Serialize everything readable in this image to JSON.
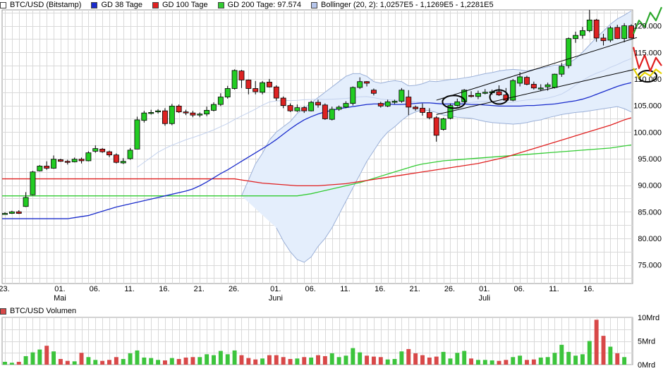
{
  "colors": {
    "up_candle": "#22cc22",
    "down_candle": "#dd2222",
    "gd38": "#1a2ccc",
    "gd100": "#e02020",
    "gd200": "#33cc33",
    "bollinger_fill": "#e4eefc",
    "bollinger_line": "#9bb0d8",
    "volume_up": "#3cc43c",
    "volume_down": "#d84848",
    "grid": "#d9d9d9"
  },
  "legend": {
    "items": [
      {
        "label": "BTC/USD (Bitstamp)",
        "color": "#ffffff"
      },
      {
        "label": "GD 38 Tage",
        "color": "#1a2ccc"
      },
      {
        "label": "GD 100 Tage",
        "color": "#e02020"
      },
      {
        "label": "GD 200 Tage: 97.574",
        "color": "#33cc33"
      },
      {
        "label": "Bollinger (20, 2): 1,0257E5 - 1,1269E5 - 1,2281E5",
        "color": "#b6c6ec"
      }
    ]
  },
  "volume_legend": {
    "label": "BTC/USD Volumen",
    "color": "#d84848"
  },
  "chart_data": [
    {
      "type": "candlestick",
      "title": "BTC/USD (Bitstamp)",
      "y_ticks": [
        "75.000",
        "80.000",
        "85.000",
        "90.000",
        "95.000",
        "100.000",
        "105.000",
        "110.000",
        "115.000",
        "120.000"
      ],
      "y_tick_values": [
        75000,
        80000,
        85000,
        90000,
        95000,
        100000,
        105000,
        110000,
        115000,
        120000
      ],
      "ylim": [
        71500,
        123000
      ],
      "x_day_labels": [
        "23.",
        "01.",
        "06.",
        "11.",
        "16.",
        "21.",
        "26.",
        "01.",
        "06.",
        "11.",
        "16.",
        "21.",
        "26.",
        "01.",
        "06.",
        "11.",
        "16."
      ],
      "x_day_label_index": [
        0,
        8,
        13,
        18,
        23,
        28,
        33,
        39,
        44,
        49,
        54,
        59,
        64,
        69,
        74,
        79,
        84
      ],
      "month_labels": [
        "Mai",
        "Juni",
        "Juli"
      ],
      "month_label_index": [
        8,
        39,
        69
      ],
      "dates_start": "2025-04-20",
      "candles": [
        [
          84600,
          84900,
          84500,
          84700
        ],
        [
          84700,
          85200,
          84600,
          85000
        ],
        [
          85000,
          85300,
          84600,
          84700
        ],
        [
          86000,
          88700,
          85900,
          87700
        ],
        [
          88200,
          92700,
          88100,
          92500
        ],
        [
          92700,
          93800,
          92600,
          93600
        ],
        [
          93600,
          94500,
          92900,
          93200
        ],
        [
          93200,
          95600,
          93100,
          94900
        ],
        [
          94800,
          95000,
          94400,
          94500
        ],
        [
          94500,
          94800,
          93900,
          94400
        ],
        [
          94400,
          95200,
          94300,
          94900
        ],
        [
          94900,
          95200,
          94100,
          94600
        ],
        [
          94600,
          96400,
          94500,
          96100
        ],
        [
          96400,
          97500,
          96100,
          96900
        ],
        [
          96800,
          97000,
          96100,
          96300
        ],
        [
          96300,
          96500,
          95300,
          95700
        ],
        [
          95700,
          96000,
          94100,
          94300
        ],
        [
          94200,
          95100,
          94000,
          94500
        ],
        [
          95000,
          97000,
          94800,
          96600
        ],
        [
          96800,
          102900,
          96800,
          102300
        ],
        [
          102200,
          104000,
          101800,
          103600
        ],
        [
          103500,
          104200,
          103300,
          103700
        ],
        [
          103800,
          104300,
          103500,
          104000
        ],
        [
          104000,
          104500,
          101200,
          101600
        ],
        [
          101600,
          105300,
          101300,
          104900
        ],
        [
          104900,
          105200,
          103600,
          103800
        ],
        [
          103800,
          104200,
          103200,
          103600
        ],
        [
          103600,
          104000,
          102800,
          103200
        ],
        [
          103300,
          103700,
          102800,
          103400
        ],
        [
          103400,
          104800,
          103000,
          104100
        ],
        [
          104100,
          105600,
          103900,
          105200
        ],
        [
          105200,
          107300,
          104900,
          106600
        ],
        [
          106600,
          108700,
          106300,
          108200
        ],
        [
          108200,
          111800,
          108000,
          111600
        ],
        [
          111500,
          111700,
          108300,
          109800
        ],
        [
          109800,
          109900,
          107100,
          108200
        ],
        [
          108200,
          109600,
          107100,
          107600
        ],
        [
          107500,
          109600,
          107100,
          109300
        ],
        [
          109400,
          110000,
          108400,
          108500
        ],
        [
          108500,
          108800,
          105900,
          106400
        ],
        [
          106400,
          106700,
          104500,
          105000
        ],
        [
          105000,
          105400,
          103800,
          104000
        ],
        [
          104000,
          105200,
          103800,
          104600
        ],
        [
          104600,
          104900,
          103600,
          104000
        ],
        [
          104000,
          105900,
          103900,
          105600
        ],
        [
          105600,
          106100,
          104600,
          105100
        ],
        [
          105100,
          105400,
          102300,
          102500
        ],
        [
          102400,
          104800,
          102200,
          104300
        ],
        [
          104300,
          105000,
          104000,
          104700
        ],
        [
          104700,
          105800,
          104500,
          105400
        ],
        [
          105400,
          108600,
          105000,
          108400
        ],
        [
          108400,
          110300,
          108100,
          109500
        ],
        [
          109500,
          109600,
          108600,
          109200
        ],
        [
          107900,
          108200,
          106900,
          107300
        ],
        [
          105400,
          105700,
          104600,
          104900
        ],
        [
          104900,
          106100,
          104700,
          105700
        ],
        [
          105600,
          106100,
          105300,
          105800
        ],
        [
          105800,
          108300,
          105500,
          107900
        ],
        [
          106600,
          107900,
          103200,
          104700
        ],
        [
          104700,
          105000,
          104000,
          104400
        ],
        [
          104500,
          105400,
          103100,
          103700
        ],
        [
          103700,
          104500,
          102400,
          102700
        ],
        [
          102700,
          103000,
          98200,
          99400
        ],
        [
          100500,
          102700,
          100300,
          102500
        ],
        [
          102600,
          105400,
          102400,
          105000
        ],
        [
          105000,
          106300,
          104800,
          105700
        ],
        [
          105700,
          108100,
          105600,
          107900
        ],
        [
          106900,
          107700,
          106500,
          106800
        ],
        [
          106700,
          107800,
          106200,
          107300
        ],
        [
          107300,
          108100,
          107100,
          107500
        ],
        [
          107400,
          108000,
          107000,
          107600
        ],
        [
          107600,
          108800,
          106800,
          107000
        ],
        [
          107000,
          108300,
          105800,
          106000
        ],
        [
          106000,
          110000,
          105800,
          109700
        ],
        [
          109200,
          111300,
          108600,
          110400
        ],
        [
          110300,
          110600,
          108800,
          109000
        ],
        [
          109000,
          109500,
          108000,
          108300
        ],
        [
          108200,
          109000,
          107700,
          108300
        ],
        [
          108500,
          109300,
          107800,
          108900
        ],
        [
          108400,
          111000,
          108200,
          110900
        ],
        [
          110900,
          113000,
          110400,
          112400
        ],
        [
          112500,
          117800,
          112000,
          117600
        ],
        [
          117600,
          118900,
          116800,
          118200
        ],
        [
          118200,
          119800,
          117600,
          119100
        ],
        [
          119100,
          123000,
          118800,
          121100
        ],
        [
          121100,
          121300,
          117000,
          117700
        ],
        [
          117700,
          118500,
          116300,
          117200
        ],
        [
          117300,
          120000,
          116900,
          119600
        ],
        [
          119700,
          120200,
          117500,
          117600
        ],
        [
          117600,
          120500,
          116900,
          120000
        ],
        [
          120000,
          120300,
          117600,
          117700
        ]
      ],
      "bollinger_upper": [
        88000,
        91000,
        94000,
        96000,
        98500,
        100000,
        101000,
        102000,
        103500,
        104500,
        105500,
        106500,
        107500,
        108500,
        109500,
        110500,
        111000,
        111000,
        110500,
        109500,
        109200,
        109500,
        109700,
        109500,
        108700,
        108800,
        109100,
        109600,
        109500,
        109700,
        109900,
        110000,
        110200,
        110400,
        110700,
        111000,
        111200,
        111500,
        111700,
        111800,
        111700,
        111500,
        111800,
        112000,
        112300,
        112600,
        112600,
        113000,
        113800,
        115000,
        116400,
        117800,
        119000,
        120300,
        121300,
        122000,
        122800
      ],
      "bollinger_upper_start": 34,
      "bollinger_lower": [
        82000,
        79500,
        77500,
        76000,
        75500,
        76500,
        78500,
        80000,
        82000,
        84500,
        87000,
        89500,
        92000,
        94500,
        96500,
        98500,
        100000,
        101000,
        102200,
        103200,
        103800,
        104200,
        104000,
        103700,
        103200,
        103000,
        102800,
        102700,
        102600,
        102300,
        102000,
        101800,
        101700,
        101600,
        101500,
        101600,
        101800,
        102100,
        102300,
        102700,
        103000,
        103300,
        103500,
        103700,
        103800,
        104000,
        104200,
        104400,
        104600,
        104800,
        104400,
        103800
      ],
      "bollinger_lower_start": 39,
      "gd38": [
        83700,
        83900,
        84100,
        84300,
        84700,
        85100,
        85500,
        85900,
        86200,
        86500,
        86800,
        87100,
        87400,
        87700,
        88000,
        88300,
        88600,
        88900,
        89300,
        89900,
        90600,
        91400,
        92200,
        92900,
        93700,
        94500,
        95300,
        96100,
        96900,
        97700,
        98600,
        99600,
        100600,
        101500,
        102300,
        102900,
        103400,
        103800,
        104100,
        104400,
        104600,
        104800,
        105000,
        105200,
        105300,
        105300,
        105300,
        105200,
        105200,
        105300,
        105400,
        105500,
        105500,
        105400,
        105300,
        105300,
        105300,
        105300,
        105200,
        105200,
        105100,
        105000,
        104900,
        104900,
        104900,
        104900,
        105000,
        105000,
        105100,
        105200,
        105300,
        105500,
        105700,
        105900,
        106200,
        106600,
        107100,
        107600,
        108100,
        108600,
        109000,
        109300
      ],
      "gd38_start": 12,
      "gd100": [
        91200,
        91000,
        90800,
        90600,
        90400,
        90300,
        90200,
        90100,
        90000,
        89900,
        89900,
        89900,
        89900,
        90000,
        90100,
        90200,
        90300,
        90500,
        90700,
        90900,
        91100,
        91300,
        91500,
        91700,
        91900,
        92100,
        92300,
        92500,
        92700,
        92900,
        93100,
        93300,
        93500,
        93700,
        93900,
        94100,
        94400,
        94700,
        95000,
        95300,
        95700,
        96100,
        96500,
        96900,
        97300,
        97700,
        98100,
        98500,
        98900,
        99300,
        99700,
        100100,
        100500,
        100900,
        101300,
        101800,
        102300,
        102700
      ],
      "gd100_start": 34,
      "gd200": [
        88000,
        88200,
        88400,
        88700,
        89000,
        89300,
        89600,
        89900,
        90200,
        90500,
        90900,
        91300,
        91700,
        92100,
        92500,
        92900,
        93300,
        93700,
        94000,
        94200,
        94400,
        94600,
        94700,
        94800,
        94900,
        95000,
        95100,
        95200,
        95300,
        95400,
        95500,
        95600,
        95700,
        95800,
        95900,
        96000,
        96100,
        96200,
        96300,
        96400,
        96500,
        96600,
        96700,
        96800,
        96900,
        97000,
        97200,
        97400,
        97574
      ],
      "gd200_start": 42,
      "projections": [
        {
          "name": "",
          "color": "#2ca82c",
          "y_values": [
            118500,
            121000,
            119800,
            122500,
            121000,
            123500
          ],
          "x_start_index": 90
        },
        {
          "name": "",
          "color": "#e02020",
          "y_values": [
            116000,
            112000,
            114500,
            111500,
            114000,
            112500
          ],
          "x_start_index": 90
        },
        {
          "name": "",
          "color": "#e8d400",
          "y_values": [
            112000,
            110200,
            111200,
            110600,
            111800,
            111000
          ],
          "x_start_index": 90
        }
      ]
    },
    {
      "type": "bar",
      "title": "BTC/USD Volumen",
      "y_ticks": [
        "10Mrd",
        "5Mrd",
        "0Mrd"
      ],
      "y_tick_values": [
        10,
        5,
        0
      ],
      "ylim": [
        0,
        10
      ],
      "values": [
        0.6,
        0.4,
        0.6,
        1.8,
        2.6,
        3.2,
        4.0,
        2.8,
        1.2,
        0.8,
        0.7,
        2.5,
        1.6,
        1.0,
        0.8,
        1.0,
        1.6,
        1.2,
        2.4,
        3.0,
        1.5,
        1.4,
        1.0,
        0.9,
        1.4,
        1.2,
        1.5,
        1.6,
        1.6,
        2.2,
        2.0,
        2.9,
        2.2,
        3.0,
        2.0,
        1.4,
        1.1,
        1.3,
        2.0,
        2.0,
        1.6,
        1.2,
        1.3,
        1.6,
        1.5,
        2.0,
        1.8,
        2.4,
        1.6,
        1.9,
        3.5,
        2.6,
        1.9,
        1.7,
        1.6,
        1.1,
        1.2,
        2.8,
        3.3,
        2.4,
        2.0,
        1.5,
        1.7,
        2.7,
        1.3,
        2.5,
        2.9,
        1.3,
        1.0,
        1.0,
        0.9,
        0.8,
        1.0,
        1.6,
        1.9,
        1.0,
        1.1,
        1.5,
        1.6,
        2.5,
        4.2,
        2.7,
        1.9,
        2.2,
        5.0,
        9.5,
        6.1,
        3.8,
        2.4,
        1.6
      ]
    }
  ]
}
